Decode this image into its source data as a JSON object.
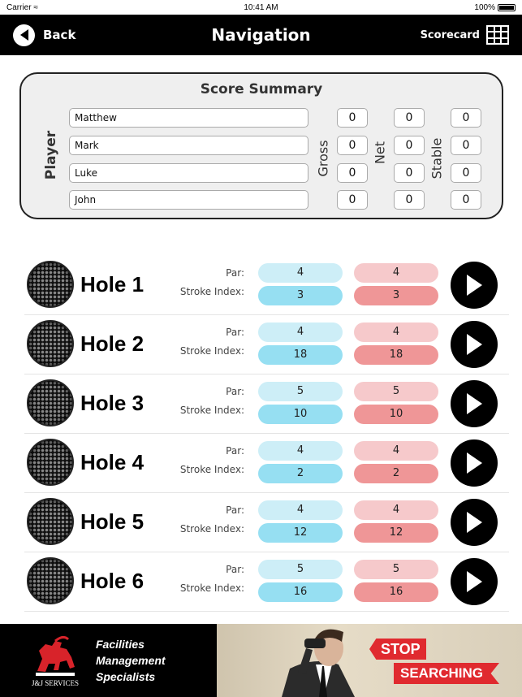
{
  "status_bar": {
    "carrier": "Carrier",
    "time": "10:41 AM",
    "battery": "100%"
  },
  "navbar": {
    "back_label": "Back",
    "title": "Navigation",
    "scorecard_label": "Scorecard"
  },
  "summary": {
    "title": "Score Summary",
    "player_label": "Player",
    "gross_label": "Gross",
    "net_label": "Net",
    "stable_label": "Stable",
    "players": [
      {
        "name": "Matthew",
        "gross": "0",
        "net": "0",
        "stable": "0"
      },
      {
        "name": "Mark",
        "gross": "0",
        "net": "0",
        "stable": "0"
      },
      {
        "name": "Luke",
        "gross": "0",
        "net": "0",
        "stable": "0"
      },
      {
        "name": "John",
        "gross": "0",
        "net": "0",
        "stable": "0"
      }
    ]
  },
  "holes": {
    "par_label": "Par:",
    "si_label": "Stroke Index:",
    "colors": {
      "blue_light": "#cdeef7",
      "blue": "#96dff2",
      "red_light": "#f6c9cb",
      "red": "#ef9697"
    },
    "items": [
      {
        "name": "Hole 1",
        "par_a": "4",
        "si_a": "3",
        "par_b": "4",
        "si_b": "3"
      },
      {
        "name": "Hole 2",
        "par_a": "4",
        "si_a": "18",
        "par_b": "4",
        "si_b": "18"
      },
      {
        "name": "Hole 3",
        "par_a": "5",
        "si_a": "10",
        "par_b": "5",
        "si_b": "10"
      },
      {
        "name": "Hole 4",
        "par_a": "4",
        "si_a": "2",
        "par_b": "4",
        "si_b": "2"
      },
      {
        "name": "Hole 5",
        "par_a": "4",
        "si_a": "12",
        "par_b": "4",
        "si_b": "12"
      },
      {
        "name": "Hole 6",
        "par_a": "5",
        "si_a": "16",
        "par_b": "5",
        "si_b": "16"
      }
    ]
  },
  "ad": {
    "logo_text": "J&J SERVICES",
    "tagline": [
      "Facilities",
      "Management",
      "Specialists"
    ],
    "banner_top": "STOP",
    "banner_bottom": "SEARCHING"
  }
}
